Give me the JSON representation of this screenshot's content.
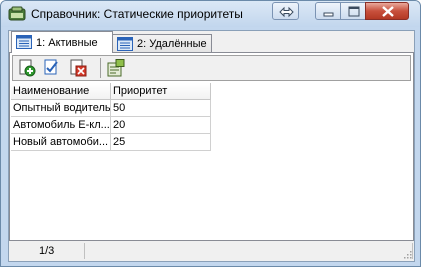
{
  "window": {
    "title": "Справочник: Статические приоритеты",
    "icons": [
      "app-icon",
      "swap-arrows-icon",
      "minimize-icon",
      "maximize-icon",
      "close-icon"
    ]
  },
  "tabs": [
    {
      "label": "1: Активные",
      "active": true
    },
    {
      "label": "2: Удалённые",
      "active": false
    }
  ],
  "toolbar": {
    "buttons": [
      "add-record-icon",
      "edit-record-icon",
      "delete-record-icon",
      "properties-icon"
    ]
  },
  "table": {
    "columns": [
      "Наименование",
      "Приоритет"
    ],
    "rows": [
      [
        "Опытный водитель",
        "50"
      ],
      [
        "Автомобиль Е-кл...",
        "20"
      ],
      [
        "Новый автомоби...",
        "25"
      ]
    ]
  },
  "status": {
    "position": "1/3"
  },
  "colors": {
    "titlebar": "#c2d6ed",
    "close_button": "#c8503d",
    "grid_line": "#d0d0d0"
  }
}
